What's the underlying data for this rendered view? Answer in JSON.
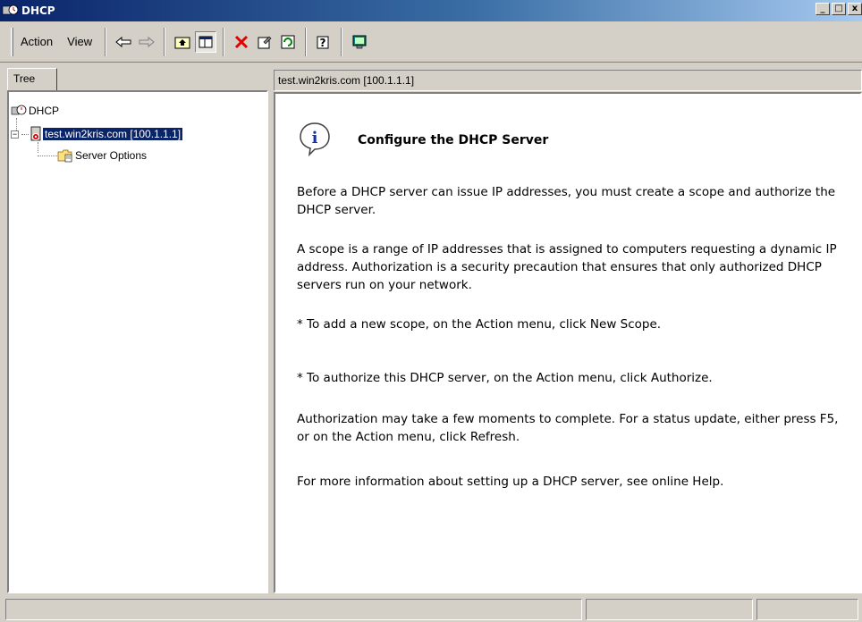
{
  "window": {
    "title": "DHCP"
  },
  "menu": {
    "action": "Action",
    "view": "View"
  },
  "tree": {
    "tab_label": "Tree",
    "root_label": "DHCP",
    "server_label": "test.win2kris.com [100.1.1.1]",
    "child_label": "Server Options"
  },
  "detail": {
    "header": "test.win2kris.com [100.1.1.1]",
    "heading": "Configure the DHCP Server",
    "paragraphs": [
      "Before a DHCP server can issue IP addresses, you must create a scope and authorize the DHCP server.",
      "A scope is a range of IP addresses that is assigned to computers requesting a dynamic IP address. Authorization is a security precaution that ensures that only authorized DHCP servers run on your network.",
      "* To add a new scope, on the Action menu, click New Scope.",
      "* To authorize this DHCP server, on the Action menu, click Authorize.",
      "Authorization may take a few moments to complete. For a status update, either press F5, or on the Action menu, click Refresh.",
      "For more information about setting up a DHCP server, see online Help."
    ]
  },
  "colors": {
    "title_start": "#0a246a",
    "title_end": "#a6caf0",
    "chrome": "#d4d0c8",
    "delete_red": "#e00000"
  }
}
